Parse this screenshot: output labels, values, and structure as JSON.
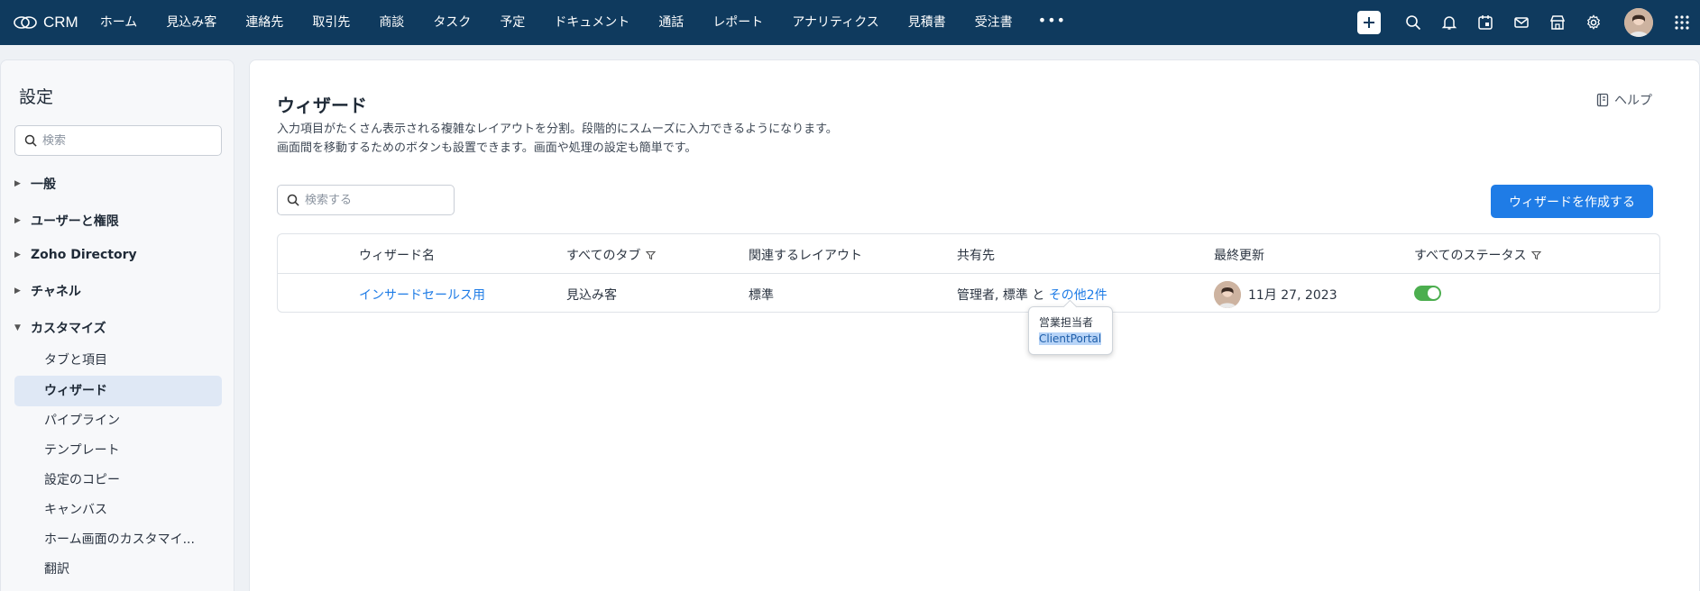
{
  "app": {
    "name": "CRM"
  },
  "nav": {
    "items": [
      "ホーム",
      "見込み客",
      "連絡先",
      "取引先",
      "商談",
      "タスク",
      "予定",
      "ドキュメント",
      "通話",
      "レポート",
      "アナリティクス",
      "見積書",
      "受注書"
    ],
    "more": "•••"
  },
  "topbar_icons": [
    "plus-icon",
    "search-icon",
    "bell-icon",
    "calendar-icon",
    "mail-icon",
    "store-icon",
    "gear-icon",
    "avatar",
    "apps-grid-icon"
  ],
  "sidebar": {
    "title": "設定",
    "search_placeholder": "検索",
    "groups": [
      "一般",
      "ユーザーと権限",
      "Zoho Directory",
      "チャネル",
      "カスタマイズ"
    ],
    "customize_items": [
      "タブと項目",
      "ウィザード",
      "パイプライン",
      "テンプレート",
      "設定のコピー",
      "キャンバス",
      "ホーム画面のカスタマイ...",
      "翻訳"
    ],
    "active_item": "ウィザード"
  },
  "main": {
    "title": "ウィザード",
    "description_line1": "入力項目がたくさん表示される複雑なレイアウトを分割。段階的にスムーズに入力できるようになります。",
    "description_line2": "画面間を移動するためのボタンも設置できます。画面や処理の設定も簡単です。",
    "help_label": "ヘルプ",
    "search_placeholder": "検索する",
    "create_button": "ウィザードを作成する",
    "table": {
      "columns": [
        "ウィザード名",
        "すべてのタブ",
        "関連するレイアウト",
        "共有先",
        "最終更新",
        "すべてのステータス"
      ],
      "rows": [
        {
          "name": "インサードセールス用",
          "tab": "見込み客",
          "layout": "標準",
          "shared_prefix": "管理者, 標準 と ",
          "shared_more": "その他2件",
          "updated": "11月 27, 2023",
          "status_on": true
        }
      ]
    },
    "tooltip": {
      "line1": "営業担当者",
      "line2": "ClientPortal"
    }
  },
  "colors": {
    "topbar": "#0f3a5e",
    "accent": "#1f7ce6",
    "toggle_on": "#4cae4f"
  }
}
